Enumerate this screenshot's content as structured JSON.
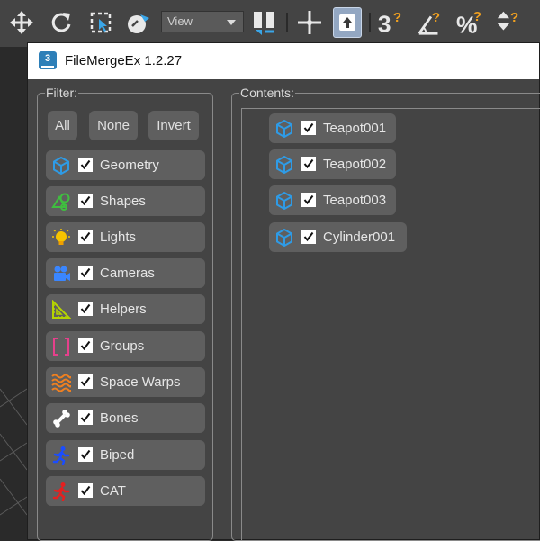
{
  "toolbar": {
    "view_dropdown": "View",
    "icons": [
      "move-icon",
      "rotate-icon",
      "select-region-icon",
      "link-icon",
      "view-dropdown",
      "snap-icon",
      "pivot-icon",
      "active-mode-icon",
      "snap-3-icon",
      "angle-snap-icon",
      "percent-snap-icon",
      "spinner-snap-icon"
    ]
  },
  "window": {
    "title": "FileMergeEx 1.2.27",
    "app_icon_text": "3"
  },
  "filter": {
    "label": "Filter:",
    "buttons": {
      "all": "All",
      "none": "None",
      "invert": "Invert"
    },
    "items": [
      {
        "label": "Geometry",
        "icon": "geometry-cube-icon",
        "checked": true,
        "color": "#2e9be6"
      },
      {
        "label": "Shapes",
        "icon": "shapes-icon",
        "checked": true,
        "color": "#3fbf3f"
      },
      {
        "label": "Lights",
        "icon": "light-bulb-icon",
        "checked": true,
        "color": "#f0b400"
      },
      {
        "label": "Cameras",
        "icon": "camera-icon",
        "checked": true,
        "color": "#3a86ff"
      },
      {
        "label": "Helpers",
        "icon": "helper-ruler-icon",
        "checked": true,
        "color": "#b6d400"
      },
      {
        "label": "Groups",
        "icon": "group-brackets-icon",
        "checked": true,
        "color": "#e6408c"
      },
      {
        "label": "Space Warps",
        "icon": "space-warp-icon",
        "checked": true,
        "color": "#f08020"
      },
      {
        "label": "Bones",
        "icon": "bone-icon",
        "checked": true,
        "color": "#ffffff"
      },
      {
        "label": "Biped",
        "icon": "biped-runner-icon",
        "checked": true,
        "color": "#1a4dff"
      },
      {
        "label": "CAT",
        "icon": "cat-runner-icon",
        "checked": true,
        "color": "#e62020"
      }
    ]
  },
  "contents": {
    "label": "Contents:",
    "items": [
      {
        "label": "Teapot001",
        "checked": true
      },
      {
        "label": "Teapot002",
        "checked": true
      },
      {
        "label": "Teapot003",
        "checked": true
      },
      {
        "label": "Cylinder001",
        "checked": true
      }
    ]
  }
}
